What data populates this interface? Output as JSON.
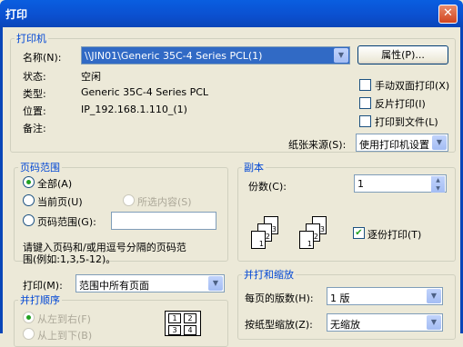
{
  "window": {
    "title": "打印",
    "close_glyph": "✕"
  },
  "printer": {
    "group_title": "打印机",
    "name_label": "名称(N):",
    "name_value": "\\\\JIN01\\Generic 35C-4 Series PCL(1)",
    "properties_button": "属性(P)...",
    "status_label": "状态:",
    "status_value": "空闲",
    "type_label": "类型:",
    "type_value": "Generic 35C-4 Series PCL",
    "location_label": "位置:",
    "location_value": "IP_192.168.1.110_(1)",
    "comment_label": "备注:",
    "duplex_label": "手动双面打印(X)",
    "duplex_checked": false,
    "reverse_label": "反片打印(I)",
    "reverse_checked": false,
    "to_file_label": "打印到文件(L)",
    "to_file_checked": false,
    "paper_source_label": "纸张来源(S):",
    "paper_source_value": "使用打印机设置"
  },
  "page_range": {
    "group_title": "页码范围",
    "all_label": "全部(A)",
    "current_label": "当前页(U)",
    "selection_label": "所选内容(S)",
    "pages_label": "页码范围(G):",
    "pages_value": "",
    "selected": "all",
    "hint_line1": "请键入页码和/或用逗号分隔的页码范",
    "hint_line2": "围(例如:1,3,5-12)。"
  },
  "copies": {
    "group_title": "副本",
    "count_label": "份数(C):",
    "count_value": "1",
    "collate_label": "逐份打印(T)",
    "collate_checked": true,
    "collate_check_glyph": "✔",
    "page_digits": [
      "3",
      "2",
      "1"
    ]
  },
  "print_what": {
    "label": "打印(M):",
    "value": "范围中所有页面"
  },
  "order": {
    "group_title": "并打顺序",
    "left_to_right": "从左到右(F)",
    "top_to_bottom": "从上到下(B)",
    "preview_digits": [
      "1",
      "2",
      "3",
      "4"
    ]
  },
  "zoom": {
    "group_title": "并打和缩放",
    "pages_per_sheet_label": "每页的版数(H):",
    "pages_per_sheet_value": "1 版",
    "scale_label": "按纸型缩放(Z):",
    "scale_value": "无缩放"
  },
  "glyphs": {
    "dropdown": "▼",
    "spin_up": "▲",
    "spin_down": "▼"
  }
}
